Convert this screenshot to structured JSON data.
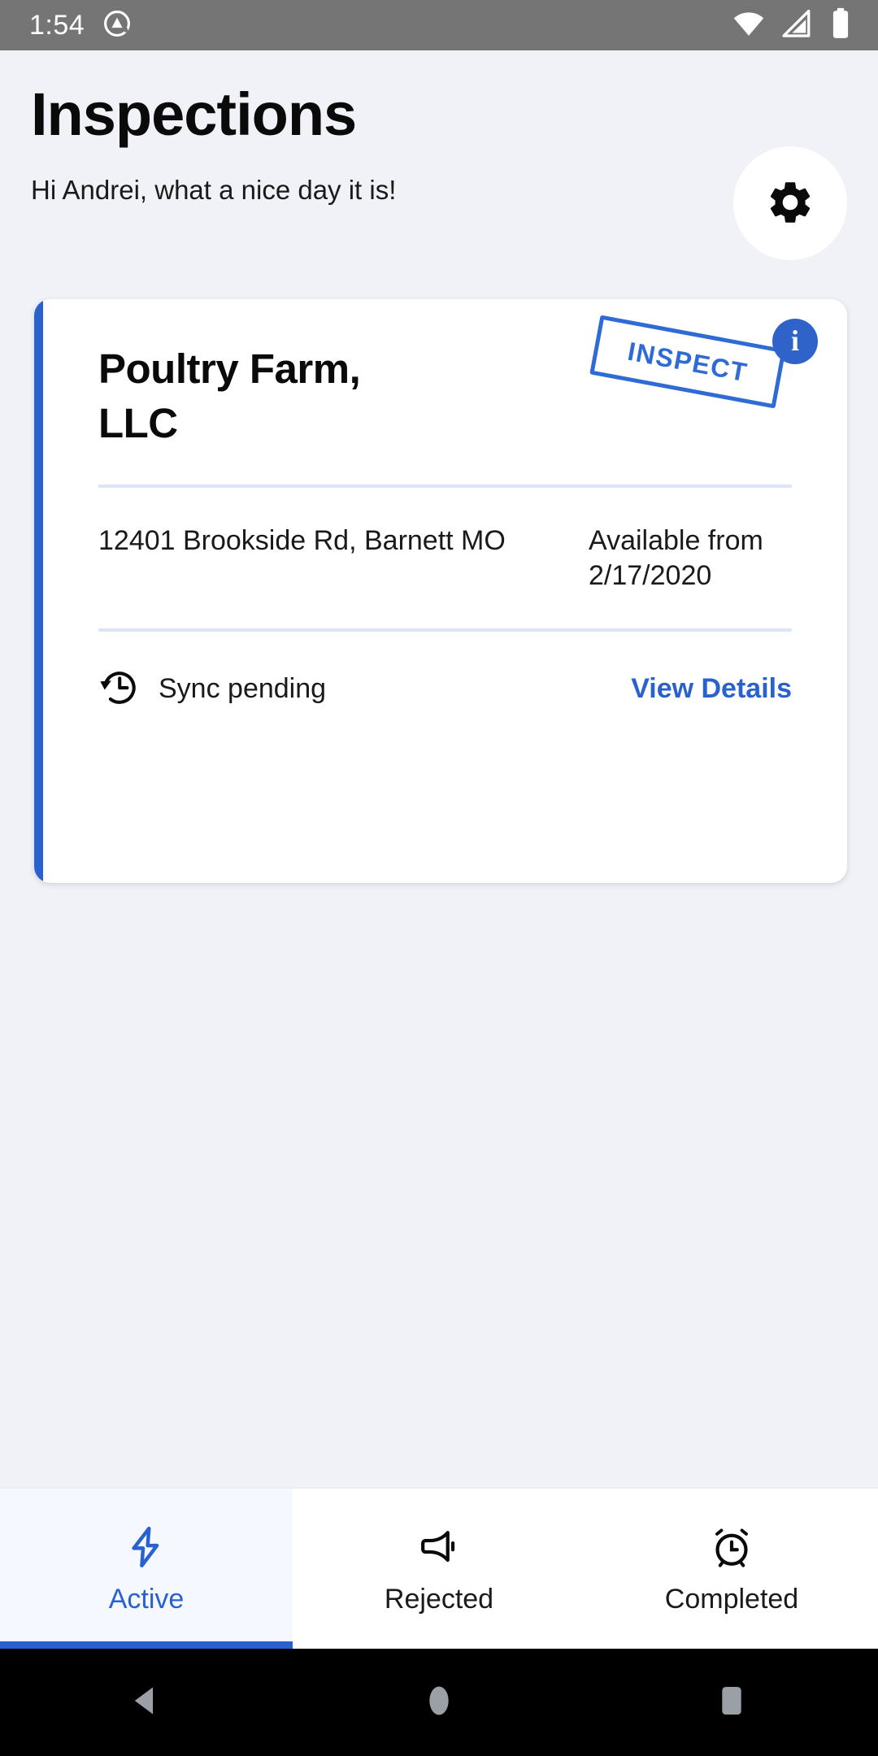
{
  "status_bar": {
    "clock": "1:54",
    "left_icons": [
      {
        "name": "app-notification-icon"
      }
    ],
    "right_icons": [
      {
        "name": "wifi-icon"
      },
      {
        "name": "cell-signal-icon"
      },
      {
        "name": "battery-icon"
      }
    ],
    "background_color": "#757575",
    "foreground_color": "#FFFFFF"
  },
  "header": {
    "title": "Inspections",
    "greeting": "Hi Andrei, what a nice day it is!",
    "settings_button": {
      "icon": "gear-icon",
      "background_color": "#FFFFFF"
    }
  },
  "card": {
    "accent_color": "#2962CE",
    "site_name": "Poultry Farm, LLC",
    "stamp": {
      "label": "INSPECT",
      "color": "#2F6BD4",
      "rotation_deg": 10.5
    },
    "info_button": {
      "icon": "info-icon",
      "glyph": "i",
      "background_color": "#2F63C9"
    },
    "address": "12401 Brookside Rd, Barnett MO",
    "availability": "Available from 2/17/2020",
    "sync": {
      "icon": "history-icon",
      "label": "Sync pending"
    },
    "view_details_label": "View Details",
    "divider_color": "#DCE6F7"
  },
  "tab_bar": {
    "selected_index": 0,
    "selected_color": "#2962CE",
    "tabs": [
      {
        "label": "Active",
        "icon": "bolt-icon",
        "selected": true
      },
      {
        "label": "Rejected",
        "icon": "campaign-icon",
        "selected": false
      },
      {
        "label": "Completed",
        "icon": "alarm-icon",
        "selected": false
      }
    ]
  },
  "android_nav": {
    "buttons": [
      {
        "name": "back-button",
        "icon": "back-triangle-icon"
      },
      {
        "name": "home-button",
        "icon": "home-circle-icon"
      },
      {
        "name": "recents-button",
        "icon": "recents-square-icon"
      }
    ],
    "background_color": "#000000",
    "icon_color": "#9AA0A6"
  },
  "page": {
    "background_color": "#F0F2F7"
  }
}
